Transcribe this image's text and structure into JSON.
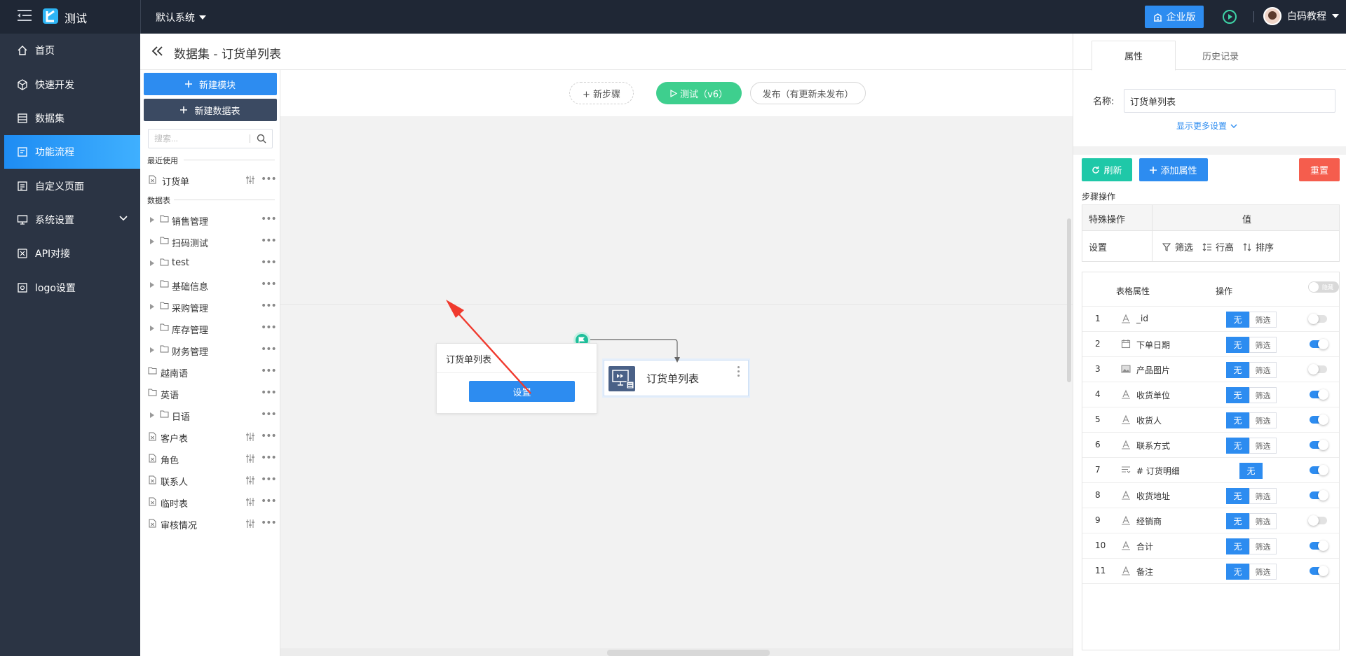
{
  "topbar": {
    "app_name": "测试",
    "system_select": "默认系统",
    "enterprise_label": "企业版",
    "user_name": "白码教程"
  },
  "sidenav": {
    "items": [
      {
        "label": "首页",
        "icon": "home-icon"
      },
      {
        "label": "快速开发",
        "icon": "cube-icon"
      },
      {
        "label": "数据集",
        "icon": "database-icon"
      },
      {
        "label": "功能流程",
        "icon": "flow-icon",
        "active": true
      },
      {
        "label": "自定义页面",
        "icon": "page-icon"
      },
      {
        "label": "系统设置",
        "icon": "monitor-icon",
        "has_submenu": true
      },
      {
        "label": "API对接",
        "icon": "api-icon"
      },
      {
        "label": "logo设置",
        "icon": "image-icon"
      }
    ]
  },
  "page": {
    "title": "数据集 - 订货单列表"
  },
  "modules": {
    "new_module": "新建模块",
    "new_table": "新建数据表",
    "search_placeholder": "搜索...",
    "recent_label": "最近使用",
    "recent": [
      {
        "label": "订货单"
      }
    ],
    "tables_label": "数据表",
    "folders": [
      {
        "label": "销售管理"
      },
      {
        "label": "扫码测试"
      },
      {
        "label": "test"
      },
      {
        "label": "基础信息"
      },
      {
        "label": "采购管理"
      },
      {
        "label": "库存管理"
      },
      {
        "label": "财务管理"
      }
    ],
    "plain_folders": [
      {
        "label": "越南语"
      },
      {
        "label": "英语"
      }
    ],
    "folder_japanese": {
      "label": "日语"
    },
    "tables": [
      {
        "label": "客户表"
      },
      {
        "label": "角色"
      },
      {
        "label": "联系人"
      },
      {
        "label": "临时表"
      },
      {
        "label": "审核情况"
      }
    ]
  },
  "canvas": {
    "new_step": "+ 新步骤",
    "test_btn": "测试（v6）",
    "publish_btn": "发布（有更新未发布）",
    "node_title": "订货单列表",
    "node_setting": "设置",
    "output_node": "订货单列表"
  },
  "rightpanel": {
    "tabs": [
      "属性",
      "历史记录"
    ],
    "name_label": "名称:",
    "name_value": "订货单列表",
    "more_settings": "显示更多设置",
    "refresh": "刷新",
    "add_property": "添加属性",
    "reset": "重置",
    "step_ops_title": "步骤操作",
    "special_ops": "特殊操作",
    "value_col": "值",
    "settings_row": "设置",
    "op_filter": "筛选",
    "op_rowheight": "行高",
    "op_sort": "排序",
    "table_prop_col": "表格属性",
    "operation_col": "操作",
    "hide_toggle": "隐藏",
    "none_label": "无",
    "filter_label": "筛选",
    "fields": [
      {
        "num": "1",
        "name": "_id",
        "icon": "text-icon",
        "has_filter": true,
        "on": false
      },
      {
        "num": "2",
        "name": "下单日期",
        "icon": "calendar-icon",
        "has_filter": true,
        "on": true
      },
      {
        "num": "3",
        "name": "产品图片",
        "icon": "image-icon",
        "has_filter": true,
        "on": false
      },
      {
        "num": "4",
        "name": "收货单位",
        "icon": "text-icon",
        "has_filter": true,
        "on": true
      },
      {
        "num": "5",
        "name": "收货人",
        "icon": "text-icon",
        "has_filter": true,
        "on": true
      },
      {
        "num": "6",
        "name": "联系方式",
        "icon": "text-icon",
        "has_filter": true,
        "on": true
      },
      {
        "num": "7",
        "name": "# 订货明细",
        "icon": "subtable-icon",
        "has_filter": false,
        "on": true
      },
      {
        "num": "8",
        "name": "收货地址",
        "icon": "text-icon",
        "has_filter": true,
        "on": true
      },
      {
        "num": "9",
        "name": "经销商",
        "icon": "text-icon",
        "has_filter": true,
        "on": false
      },
      {
        "num": "10",
        "name": "合计",
        "icon": "text-icon",
        "has_filter": true,
        "on": true
      },
      {
        "num": "11",
        "name": "备注",
        "icon": "text-icon",
        "has_filter": true,
        "on": true
      }
    ]
  }
}
